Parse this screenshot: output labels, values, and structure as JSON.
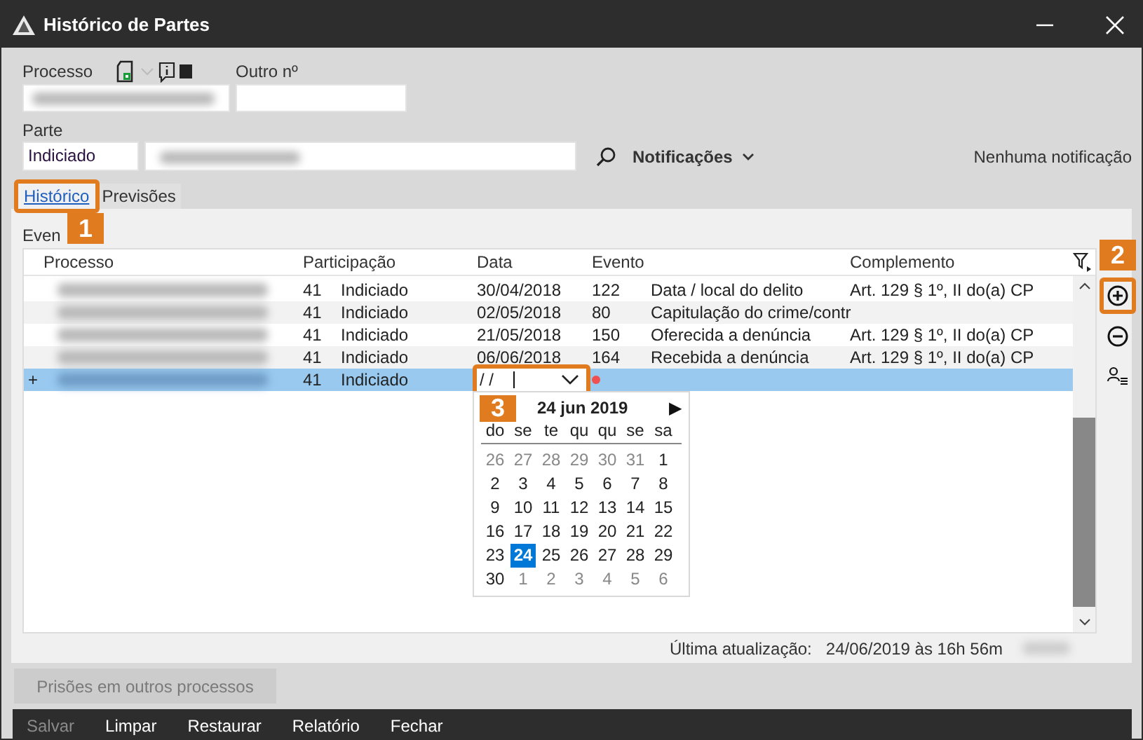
{
  "window": {
    "title": "Histórico de Partes"
  },
  "form": {
    "processo_label": "Processo",
    "processo": {
      "redacted": true
    },
    "outro_label": "Outro nº",
    "parte_label": "Parte",
    "parte_type": "Indiciado",
    "parte_name": {
      "redacted": true
    },
    "notifications_label": "Notificações",
    "notifications_status": "Nenhuma notificação"
  },
  "tabs": [
    {
      "label": "Histórico",
      "selected": true,
      "callout": "1"
    },
    {
      "label": "Previsões",
      "selected": false
    }
  ],
  "events_label": "Even",
  "table": {
    "columns": [
      "Processo",
      "Participação",
      "Data",
      "Evento",
      "Complemento"
    ],
    "rows": [
      {
        "new": false,
        "selected": false,
        "processo_redacted": true,
        "participacao_code": "41",
        "participacao": "Indiciado",
        "data": "30/04/2018",
        "evento_code": "122",
        "evento": "Data / local do delito",
        "complemento": "Art. 129 § 1º, II do(a) CP"
      },
      {
        "new": false,
        "selected": false,
        "processo_redacted": true,
        "participacao_code": "41",
        "participacao": "Indiciado",
        "data": "02/05/2018",
        "evento_code": "80",
        "evento": "Capitulação do crime/contr"
      },
      {
        "new": false,
        "selected": false,
        "processo_redacted": true,
        "participacao_code": "41",
        "participacao": "Indiciado",
        "data": "21/05/2018",
        "evento_code": "150",
        "evento": "Oferecida a denúncia",
        "complemento": "Art. 129 § 1º, II do(a) CP"
      },
      {
        "new": false,
        "selected": false,
        "processo_redacted": true,
        "participacao_code": "41",
        "participacao": "Indiciado",
        "data": "06/06/2018",
        "evento_code": "164",
        "evento": "Recebida a denúncia",
        "complemento": "Art. 129 § 1º, II do(a) CP"
      },
      {
        "new": true,
        "new_marker": "+",
        "selected": true,
        "processo_redacted": true,
        "participacao_code": "41",
        "participacao": "Indiciado",
        "date_editor": {
          "value": "/ /",
          "required": true,
          "callout": "3"
        }
      }
    ]
  },
  "calendar": {
    "title": "24 jun 2019",
    "next": "▶",
    "weekdays": [
      "do",
      "se",
      "te",
      "qu",
      "qu",
      "se",
      "sa"
    ],
    "days": [
      {
        "day": "26",
        "other_month": true,
        "selected": false
      },
      {
        "day": "27",
        "other_month": true,
        "selected": false
      },
      {
        "day": "28",
        "other_month": true,
        "selected": false
      },
      {
        "day": "29",
        "other_month": true,
        "selected": false
      },
      {
        "day": "30",
        "other_month": true,
        "selected": false
      },
      {
        "day": "31",
        "other_month": true,
        "selected": false
      },
      {
        "day": "1",
        "other_month": false,
        "selected": false
      },
      {
        "day": "2",
        "other_month": false,
        "selected": false
      },
      {
        "day": "3",
        "other_month": false,
        "selected": false
      },
      {
        "day": "4",
        "other_month": false,
        "selected": false
      },
      {
        "day": "5",
        "other_month": false,
        "selected": false
      },
      {
        "day": "6",
        "other_month": false,
        "selected": false
      },
      {
        "day": "7",
        "other_month": false,
        "selected": false
      },
      {
        "day": "8",
        "other_month": false,
        "selected": false
      },
      {
        "day": "9",
        "other_month": false,
        "selected": false
      },
      {
        "day": "10",
        "other_month": false,
        "selected": false
      },
      {
        "day": "11",
        "other_month": false,
        "selected": false
      },
      {
        "day": "12",
        "other_month": false,
        "selected": false
      },
      {
        "day": "13",
        "other_month": false,
        "selected": false
      },
      {
        "day": "14",
        "other_month": false,
        "selected": false
      },
      {
        "day": "15",
        "other_month": false,
        "selected": false
      },
      {
        "day": "16",
        "other_month": false,
        "selected": false
      },
      {
        "day": "17",
        "other_month": false,
        "selected": false
      },
      {
        "day": "18",
        "other_month": false,
        "selected": false
      },
      {
        "day": "19",
        "other_month": false,
        "selected": false
      },
      {
        "day": "20",
        "other_month": false,
        "selected": false
      },
      {
        "day": "21",
        "other_month": false,
        "selected": false
      },
      {
        "day": "22",
        "other_month": false,
        "selected": false
      },
      {
        "day": "23",
        "other_month": false,
        "selected": false
      },
      {
        "day": "24",
        "other_month": false,
        "selected": true
      },
      {
        "day": "25",
        "other_month": false,
        "selected": false
      },
      {
        "day": "26",
        "other_month": false,
        "selected": false
      },
      {
        "day": "27",
        "other_month": false,
        "selected": false
      },
      {
        "day": "28",
        "other_month": false,
        "selected": false
      },
      {
        "day": "29",
        "other_month": false,
        "selected": false
      },
      {
        "day": "30",
        "other_month": false,
        "selected": false
      },
      {
        "day": "1",
        "other_month": true,
        "selected": false
      },
      {
        "day": "2",
        "other_month": true,
        "selected": false
      },
      {
        "day": "3",
        "other_month": true,
        "selected": false
      },
      {
        "day": "4",
        "other_month": true,
        "selected": false
      },
      {
        "day": "5",
        "other_month": true,
        "selected": false
      },
      {
        "day": "6",
        "other_month": true,
        "selected": false
      }
    ]
  },
  "toolbar": [
    {
      "kind": "add",
      "callout": "2"
    },
    {
      "kind": "remove"
    },
    {
      "kind": "participants"
    }
  ],
  "status": {
    "label": "Última atualização:",
    "value": "24/06/2019 às 16h 56m",
    "user_redacted": true
  },
  "secondary_button": {
    "label": "Prisões em outros processos",
    "disabled": true
  },
  "footer_buttons": [
    {
      "label": "Salvar",
      "disabled": true
    },
    {
      "label": "Limpar",
      "disabled": false
    },
    {
      "label": "Restaurar",
      "disabled": false
    },
    {
      "label": "Relatório",
      "disabled": false
    },
    {
      "label": "Fechar",
      "disabled": false
    }
  ]
}
